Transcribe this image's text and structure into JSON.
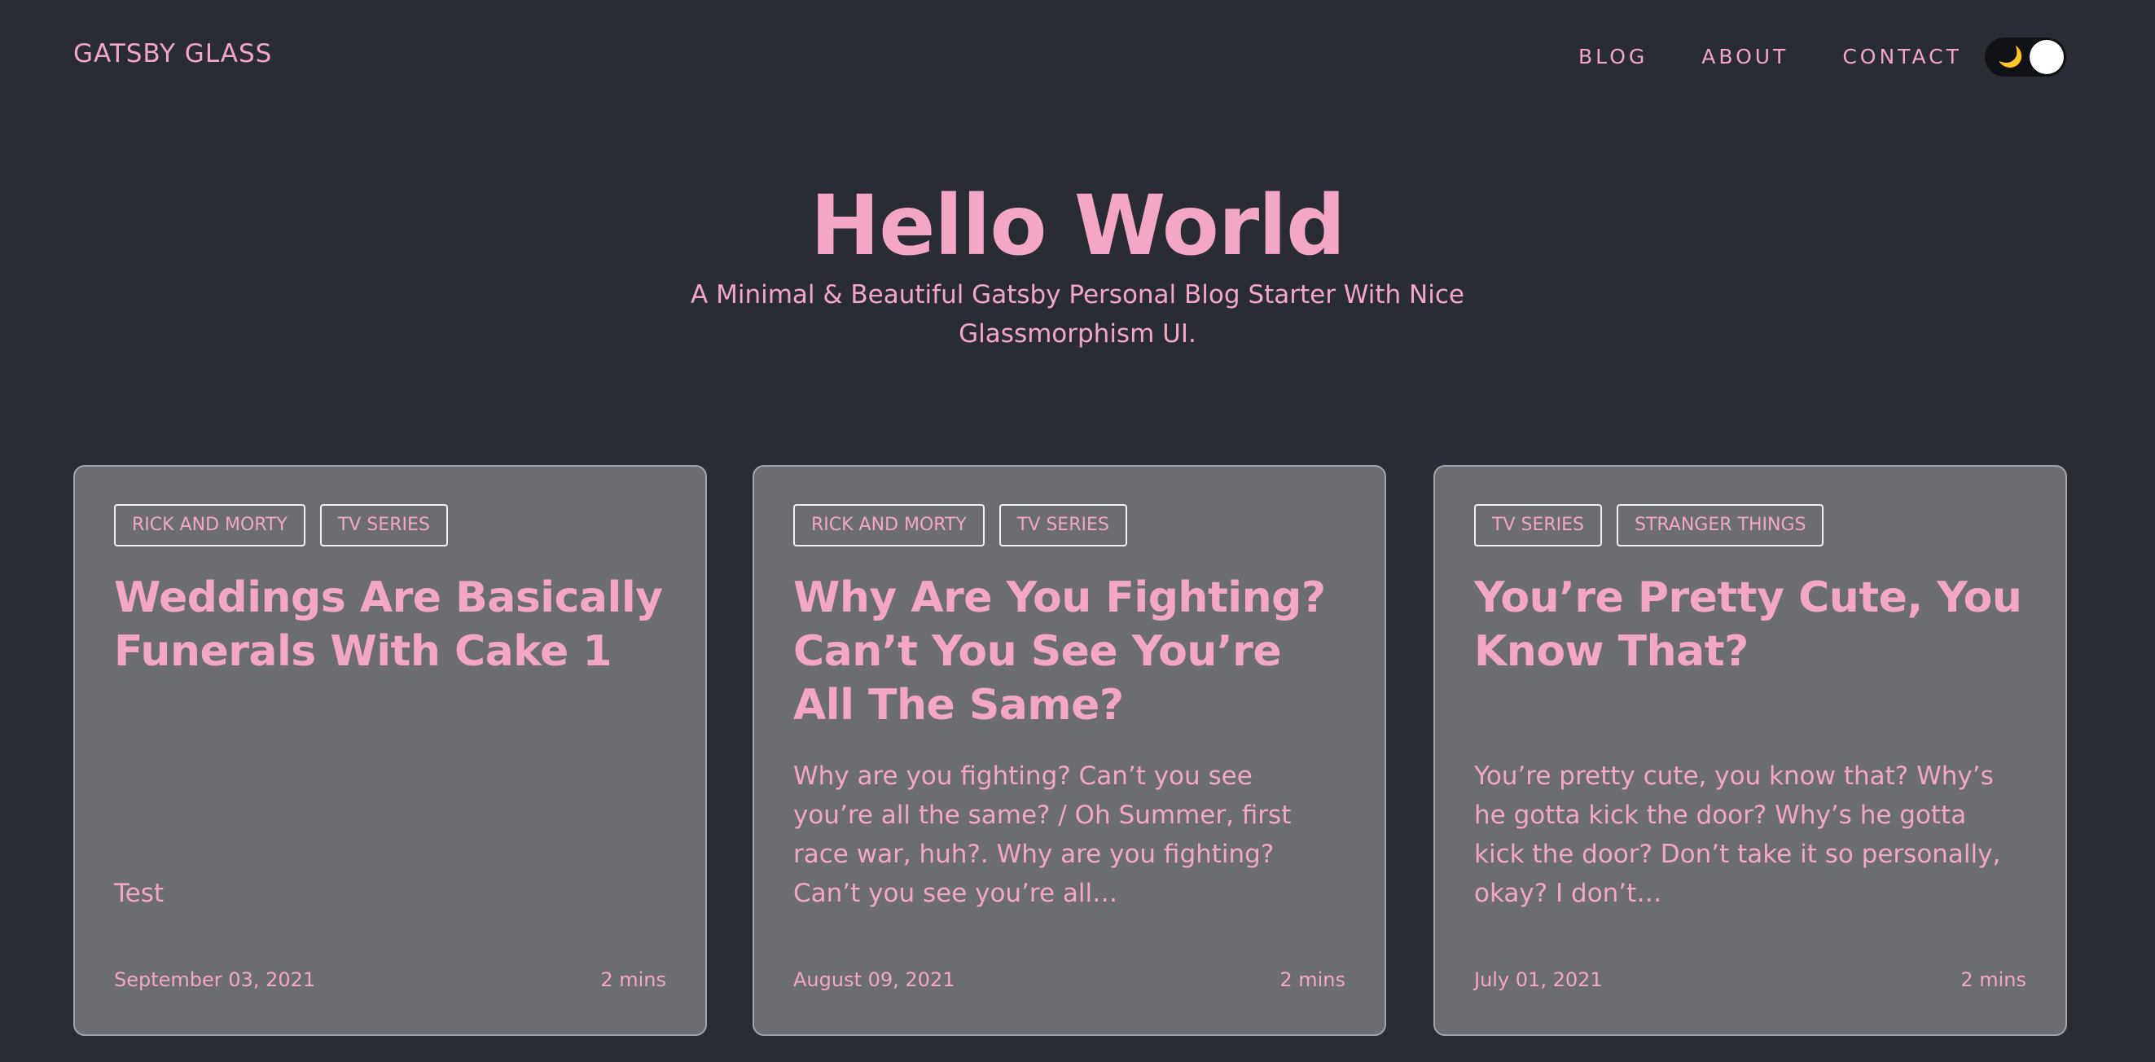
{
  "brand": {
    "title": "GATSBY GLASS"
  },
  "nav": {
    "items": [
      "BLOG",
      "ABOUT",
      "CONTACT"
    ]
  },
  "theme_toggle": {
    "icon": "moon-icon",
    "moon_glyph": "🌙"
  },
  "hero": {
    "title": "Hello World",
    "subtitle": "A Minimal & Beautiful Gatsby Personal Blog Starter With Nice Glassmorphism UI."
  },
  "posts": [
    {
      "tags": [
        "RICK AND MORTY",
        "TV SERIES"
      ],
      "title": "Weddings Are Basically Funerals With Cake 1",
      "excerpt": "Test",
      "date": "September 03, 2021",
      "read_time": "2 mins"
    },
    {
      "tags": [
        "RICK AND MORTY",
        "TV SERIES"
      ],
      "title": "Why Are You Fighting? Can’t You See You’re All The Same?",
      "excerpt": "Why are you fighting? Can’t you see you’re all the same? / Oh Summer, first race war, huh?. Why are you fighting? Can’t you see you’re all…",
      "date": "August 09, 2021",
      "read_time": "2 mins"
    },
    {
      "tags": [
        "TV SERIES",
        "STRANGER THINGS"
      ],
      "title": "You’re Pretty Cute, You Know That?",
      "excerpt": "You’re pretty cute, you know that? Why’s he gotta kick the door? Why’s he gotta kick the door? Don’t take it so personally, okay? I don’t…",
      "date": "July 01, 2021",
      "read_time": "2 mins"
    }
  ],
  "colors": {
    "background": "#292c35",
    "accent": "#f4a7c4",
    "card": "#6c6d71"
  }
}
